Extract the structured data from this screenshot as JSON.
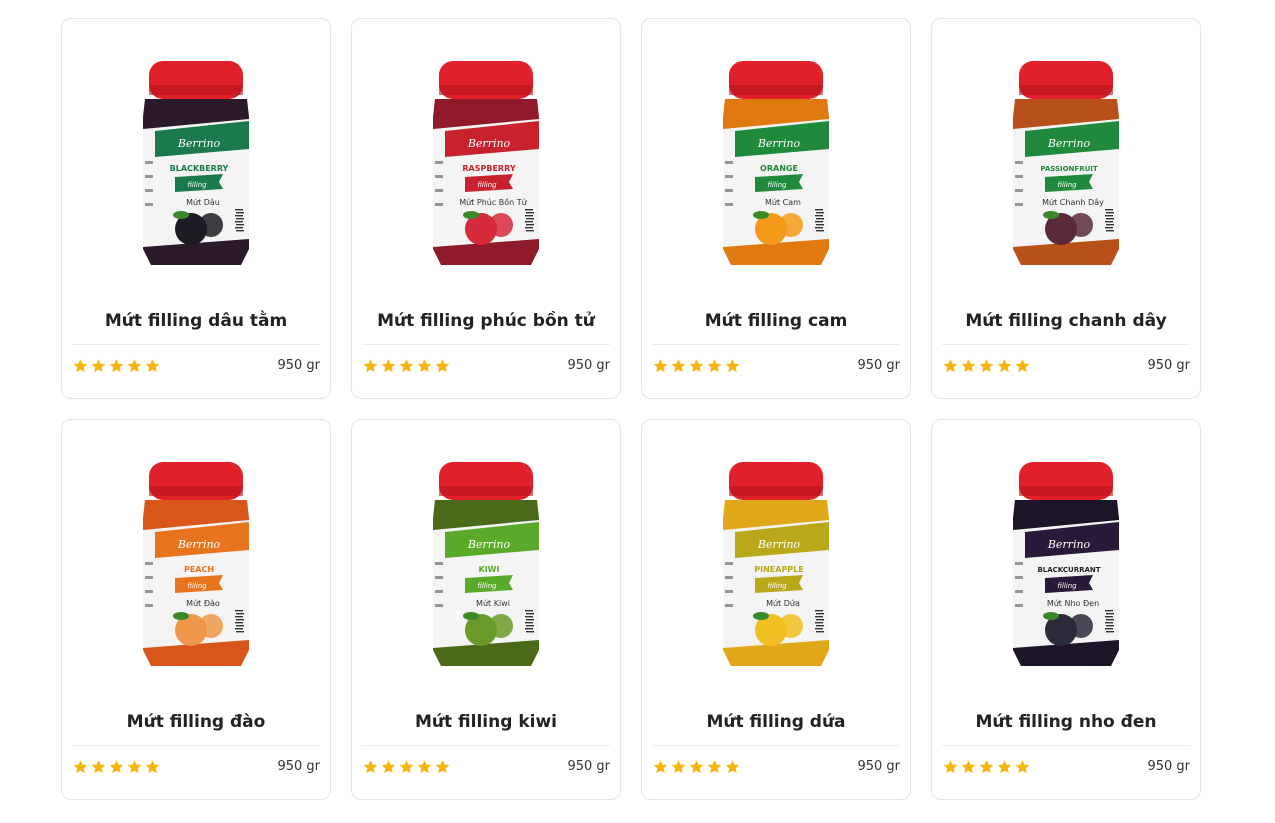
{
  "products": [
    {
      "name": "Mứt filling dâu tằm",
      "weight": "950 gr",
      "rating": 5,
      "label_en": "BLACKBERRY",
      "label_vi": "Mứt Dâu",
      "color": "#1a7a4c",
      "fill": "#2a1a2a",
      "fruit": "#1c1c24"
    },
    {
      "name": "Mứt filling phúc bồn tử",
      "weight": "950 gr",
      "rating": 5,
      "label_en": "RASPBERRY",
      "label_vi": "Mứt Phúc Bồn Tử",
      "color": "#c8232c",
      "fill": "#8e1a2a",
      "fruit": "#d42a3a"
    },
    {
      "name": "Mứt filling cam",
      "weight": "950 gr",
      "rating": 5,
      "label_en": "ORANGE",
      "label_vi": "Mứt Cam",
      "color": "#1f8a3c",
      "fill": "#e07a10",
      "fruit": "#f59a18"
    },
    {
      "name": "Mứt filling chanh dây",
      "weight": "950 gr",
      "rating": 5,
      "label_en": "PASSIONFRUIT",
      "label_vi": "Mứt Chanh Dây",
      "color": "#1f8a3c",
      "fill": "#b8501a",
      "fruit": "#5a2a3a"
    },
    {
      "name": "Mứt filling đào",
      "weight": "950 gr",
      "rating": 5,
      "label_en": "PEACH",
      "label_vi": "Mứt Đào",
      "color": "#e8741e",
      "fill": "#d8561a",
      "fruit": "#f0984a"
    },
    {
      "name": "Mứt filling kiwi",
      "weight": "950 gr",
      "rating": 5,
      "label_en": "KIWI",
      "label_vi": "Mứt Kiwi",
      "color": "#5aaa2a",
      "fill": "#4a6a1a",
      "fruit": "#6a9a2a"
    },
    {
      "name": "Mứt filling dứa",
      "weight": "950 gr",
      "rating": 5,
      "label_en": "PINEAPPLE",
      "label_vi": "Mứt Dứa",
      "color": "#b8a81a",
      "fill": "#e0a818",
      "fruit": "#f0c020"
    },
    {
      "name": "Mứt filling nho đen",
      "weight": "950 gr",
      "rating": 5,
      "label_en": "BLACKCURRANT",
      "label_vi": "Mứt Nho Đen",
      "color": "#2a1a3a",
      "fill": "#1e1428",
      "fruit": "#2a2a3a"
    }
  ],
  "brand": "Berrino",
  "filling_word": "filling",
  "colors": {
    "cap": "#e2202a",
    "star": "#f5b50a",
    "border": "#e6e6e6"
  },
  "icons": {
    "rating": "star-icon"
  }
}
